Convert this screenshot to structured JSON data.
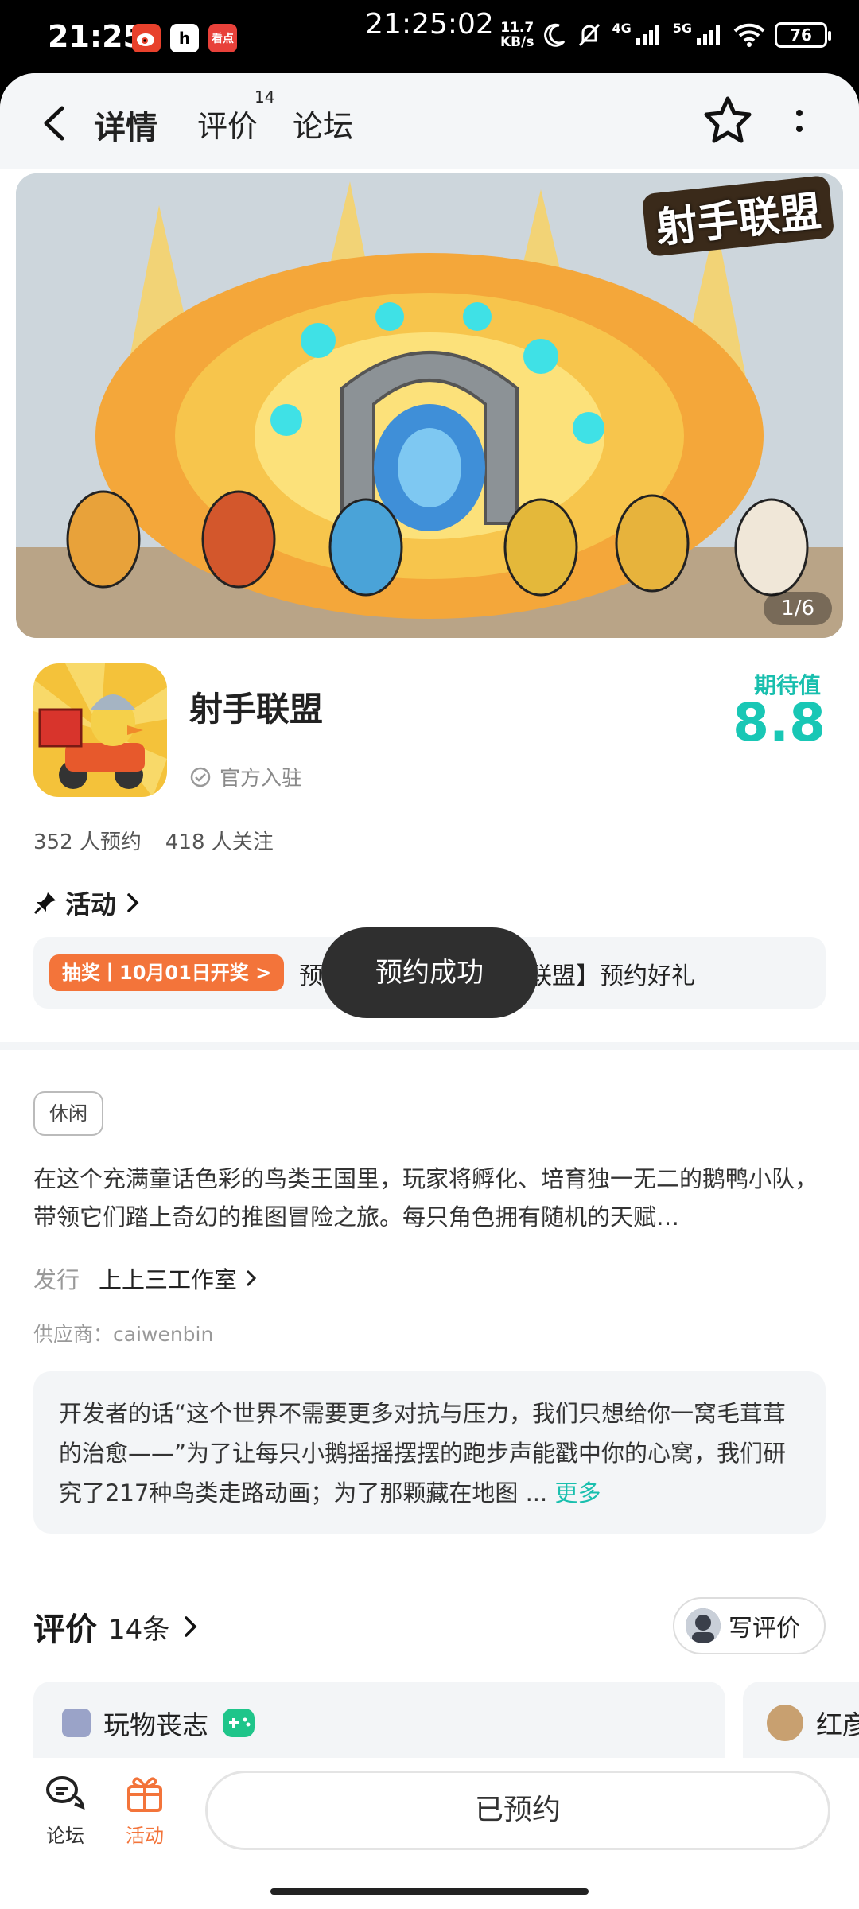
{
  "status_bar": {
    "time": "21:25",
    "center_time": "21:25:02",
    "net_speed_value": "11.7",
    "net_speed_unit": "KB/s",
    "signal_4g": "4G",
    "signal_5g": "5G",
    "battery": "76",
    "apps": [
      "weibo",
      "h-app",
      "看点"
    ]
  },
  "nav": {
    "tabs": [
      {
        "label": "详情",
        "active": true
      },
      {
        "label": "评价",
        "badge": "14"
      },
      {
        "label": "论坛"
      }
    ]
  },
  "banner": {
    "logo_text": "射手联盟",
    "counter": "1/6"
  },
  "app": {
    "name": "射手联盟",
    "official": "官方入驻",
    "expect_label": "期待值",
    "expect_value": "8.8",
    "reservations": "352 人预约",
    "followers": "418 人关注"
  },
  "activity": {
    "title": "活动",
    "tag": "抽奖丨10月01日开奖 >",
    "text_left": "预",
    "text_right": "联盟】预约好礼"
  },
  "toast": "预约成功",
  "details": {
    "genre": "休闲",
    "description": "在这个充满童话色彩的鸟类王国里，玩家将孵化、培育独一无二的鹅鸭小队，带领它们踏上奇幻的推图冒险之旅。每只角色拥有随机的天赋…",
    "publisher_label": "发行",
    "publisher": "上上三工作室",
    "supplier": "供应商：caiwenbin",
    "dev_words": "开发者的话“这个世界不需要更多对抗与压力，我们只想给你一窝毛茸茸的治愈——”为了让每只小鹅摇摇摆摆的跑步声能戳中你的心窝，我们研究了217种鸟类走路动画；为了那颗藏在地图 ...",
    "more": "更多"
  },
  "reviews": {
    "title": "评价",
    "count": "14条",
    "write_button": "写评价",
    "cards": [
      {
        "name": "玩物丧志"
      },
      {
        "name": "红彦"
      }
    ]
  },
  "bottom": {
    "forum": "论坛",
    "activity": "活动",
    "reserved": "已预约"
  },
  "colors": {
    "accent": "#19c7b5",
    "orange": "#f3743a",
    "toast_bg": "#2f2f2f"
  }
}
